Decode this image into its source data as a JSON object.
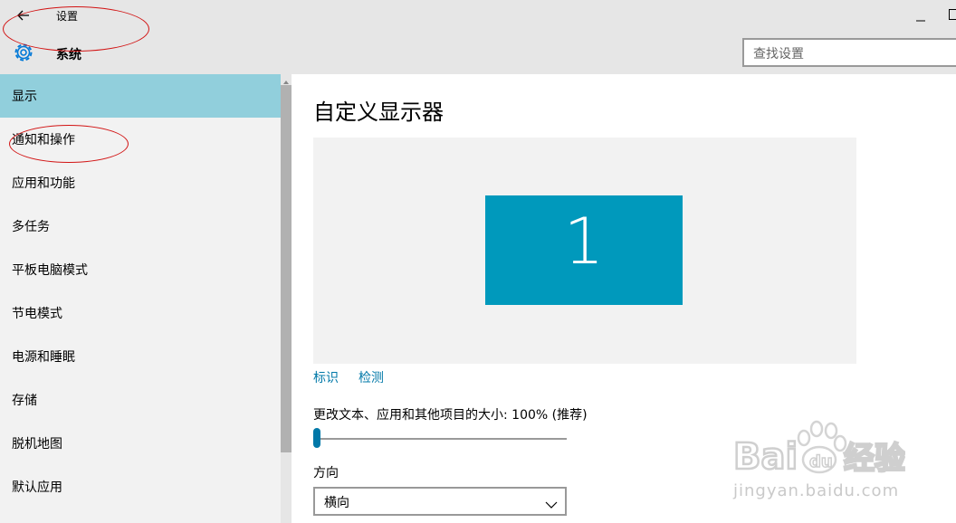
{
  "window": {
    "title": "设置",
    "section": "系统"
  },
  "search": {
    "placeholder": "查找设置"
  },
  "sidebar": {
    "items": [
      {
        "label": "显示",
        "active": true
      },
      {
        "label": "通知和操作",
        "active": false
      },
      {
        "label": "应用和功能",
        "active": false
      },
      {
        "label": "多任务",
        "active": false
      },
      {
        "label": "平板电脑模式",
        "active": false
      },
      {
        "label": "节电模式",
        "active": false
      },
      {
        "label": "电源和睡眠",
        "active": false
      },
      {
        "label": "存储",
        "active": false
      },
      {
        "label": "脱机地图",
        "active": false
      },
      {
        "label": "默认应用",
        "active": false
      }
    ]
  },
  "main": {
    "title": "自定义显示器",
    "monitor_number": "1",
    "identify_link": "标识",
    "detect_link": "检测",
    "scale_label": "更改文本、应用和其他项目的大小: 100% (推荐)",
    "scale_slider_value": 0,
    "orientation_label": "方向",
    "orientation_value": "横向"
  },
  "watermark": {
    "url": "jingyan.baidu.com"
  },
  "colors": {
    "accent": "#0099bc",
    "link": "#0078a8",
    "active_item": "#91cfdc",
    "annotation": "#d21414"
  }
}
